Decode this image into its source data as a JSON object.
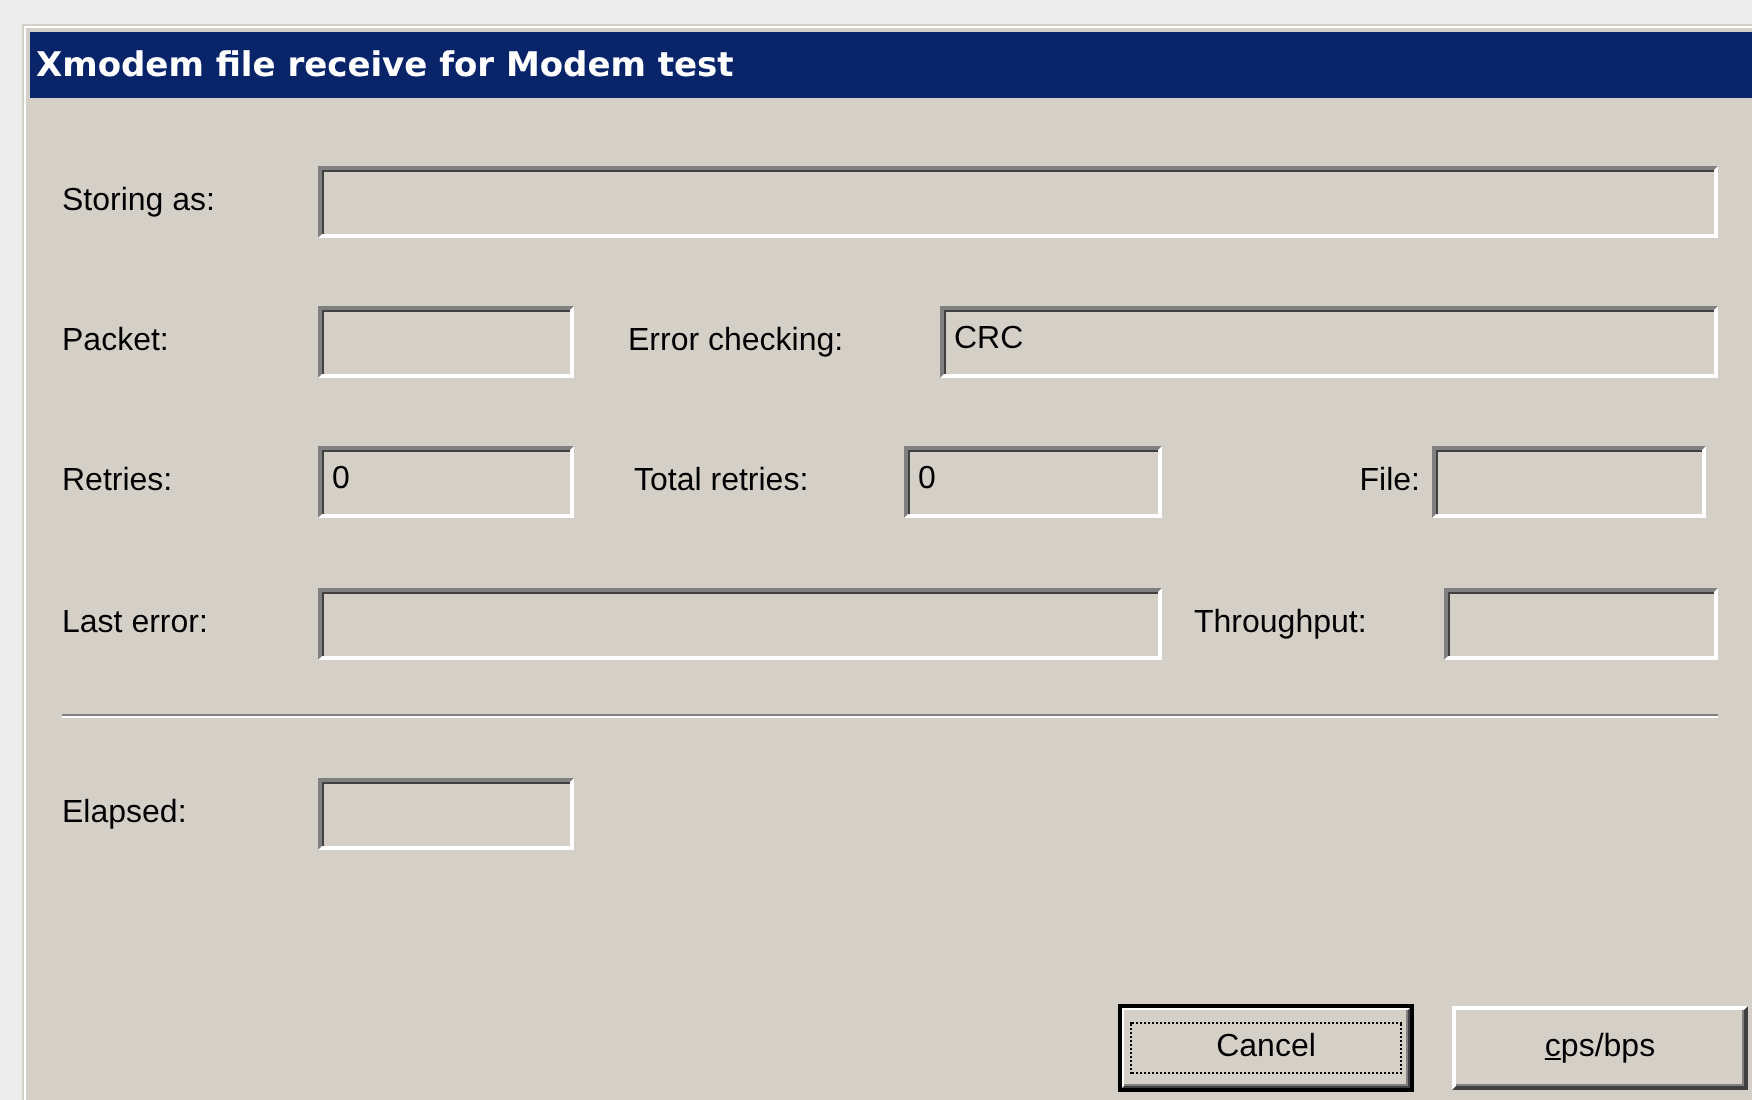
{
  "window": {
    "title": "Xmodem file receive for Modem test"
  },
  "rows": [
    {
      "fields": [
        {
          "label": "Storing as:"
        }
      ]
    },
    {
      "fields": [
        {
          "label": "Packet:"
        },
        {
          "label": "Error checking:",
          "value": "CRC"
        }
      ]
    },
    {
      "fields": [
        {
          "label": "Retries:",
          "value": "0"
        },
        {
          "label": "Total retries:",
          "value": "0"
        },
        {
          "label": "File:"
        }
      ]
    },
    {
      "fields": [
        {
          "label": "Last error:"
        },
        {
          "label": "Throughput:"
        }
      ]
    }
  ],
  "elapsed": {
    "label": "Elapsed:"
  },
  "buttons": [
    {
      "label": "Cancel",
      "focused": true,
      "first_letter_underlined": false
    },
    {
      "label": "cps/bps",
      "focused": false,
      "first_letter_underlined": true
    }
  ]
}
